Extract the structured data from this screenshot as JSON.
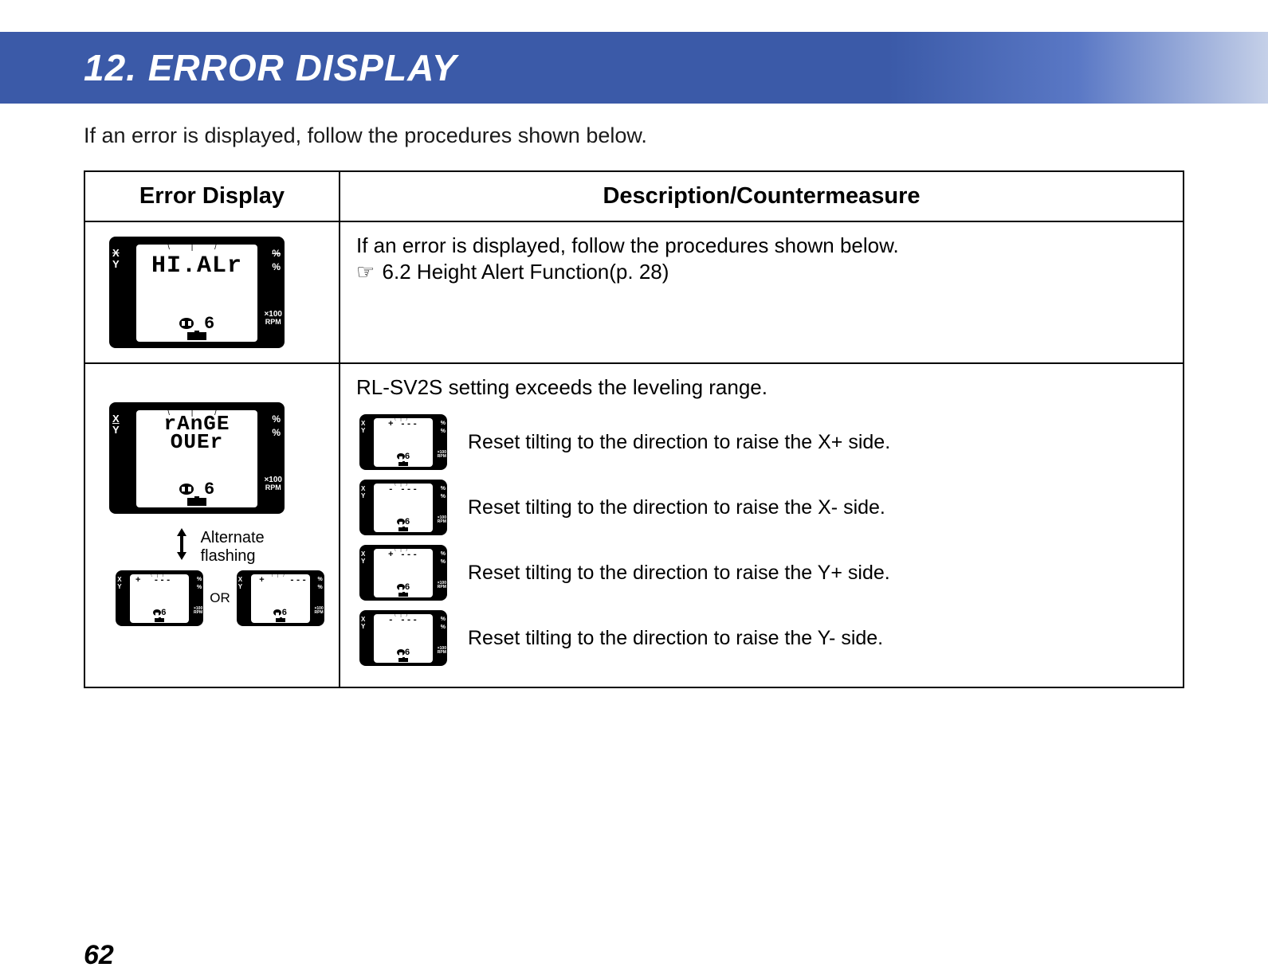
{
  "header": {
    "title": "12.  ERROR DISPLAY"
  },
  "intro": "If an error is displayed, follow the procedures shown below.",
  "table": {
    "headers": {
      "col1": "Error Display",
      "col2": "Description/Countermeasure"
    },
    "row1": {
      "lcd_text": "HI.ALr",
      "lcd_num": "6",
      "desc_line1": "If an error is displayed, follow the procedures shown below.",
      "ref": "6.2 Height Alert Function(p. 28)"
    },
    "row2": {
      "lcd_line1": "rAnGE",
      "lcd_line2": "OUEr",
      "lcd_num": "6",
      "altflash_label_l1": "Alternate",
      "altflash_label_l2": "flashing",
      "or_text": "OR",
      "small_lcd_a": "+  ---  ",
      "small_lcd_b": " +    ---",
      "title": "RL-SV2S setting exceeds the leveling range.",
      "items": [
        {
          "lcd": "+ ---",
          "text": "Reset tilting to the direction to raise the X+ side."
        },
        {
          "lcd": "- ---",
          "text": "Reset tilting to the direction to raise the X- side."
        },
        {
          "lcd": "+ ---",
          "text": "Reset tilting to the direction to raise the Y+ side."
        },
        {
          "lcd": "- ---",
          "text": "Reset tilting to the direction to raise the Y- side."
        }
      ]
    }
  },
  "lcd_common": {
    "axis_x": "X",
    "axis_y": "Y",
    "pct": "%",
    "x100": "×100",
    "rpm": "RPM"
  },
  "page_number": "62"
}
